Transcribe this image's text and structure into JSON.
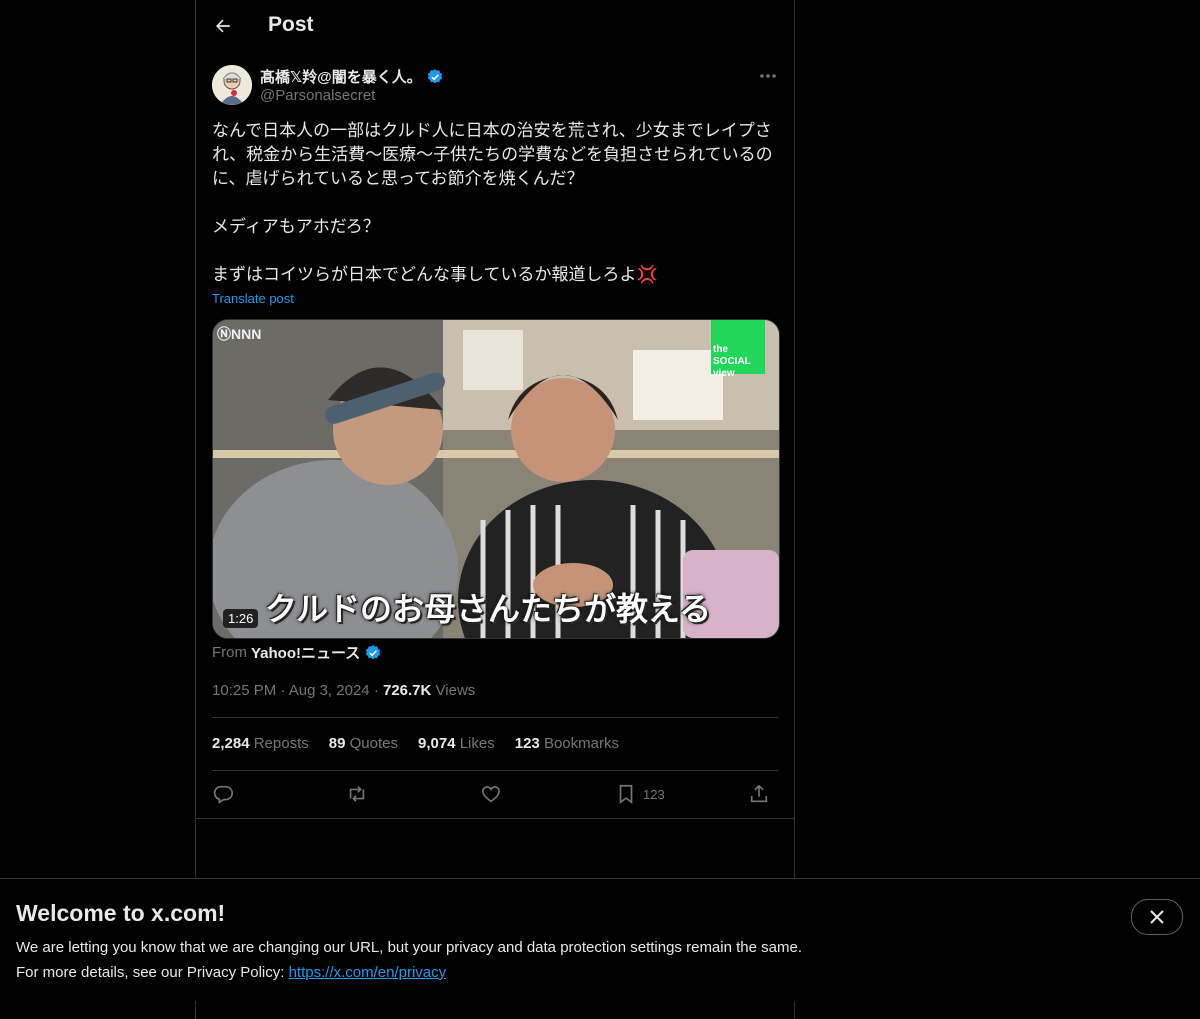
{
  "header": {
    "title": "Post"
  },
  "author": {
    "display_name": "髙橋𝕏羚@闇を暴く人。",
    "handle": "@Parsonalsecret",
    "verified": true
  },
  "post": {
    "text": "なんで日本人の一部はクルド人に日本の治安を荒され、少女までレイプされ、税金から生活費〜医療〜子供たちの学費などを負担させられているのに、虐げられていると思ってお節介を焼くんだ？\n\nメディアもアホだろ？\n\nまずはコイツらが日本でどんな事しているか報道しろよ💢",
    "translate_label": "Translate post"
  },
  "media": {
    "duration": "1:26",
    "caption": "クルドのお母さんたちが教える",
    "logo_text": "ⓃNNN",
    "corner_badge_text": "the SOCIAL view"
  },
  "source": {
    "prefix": "From",
    "name": "Yahoo!ニュース",
    "verified": true
  },
  "meta": {
    "time": "10:25 PM",
    "date": "Aug 3, 2024",
    "views_count": "726.7K",
    "views_label": "Views",
    "separator": "·"
  },
  "stats": {
    "reposts": {
      "count": "2,284",
      "label": "Reposts"
    },
    "quotes": {
      "count": "89",
      "label": "Quotes"
    },
    "likes": {
      "count": "9,074",
      "label": "Likes"
    },
    "bookmarks": {
      "count": "123",
      "label": "Bookmarks"
    }
  },
  "actions": {
    "bookmark_count": "123"
  },
  "banner": {
    "title": "Welcome to x.com!",
    "line1": "We are letting you know that we are changing our URL, but your privacy and data protection settings remain the same.",
    "line2_prefix": "For more details, see our Privacy Policy: ",
    "link": "https://x.com/en/privacy"
  },
  "colors": {
    "accent": "#1d9bf0",
    "background": "#000000",
    "border": "#2f3336",
    "muted": "#71767b"
  },
  "icons": [
    "back-arrow-icon",
    "verified-badge-icon",
    "more-icon",
    "reply-icon",
    "repost-icon",
    "like-icon",
    "bookmark-icon",
    "share-icon",
    "close-icon"
  ]
}
